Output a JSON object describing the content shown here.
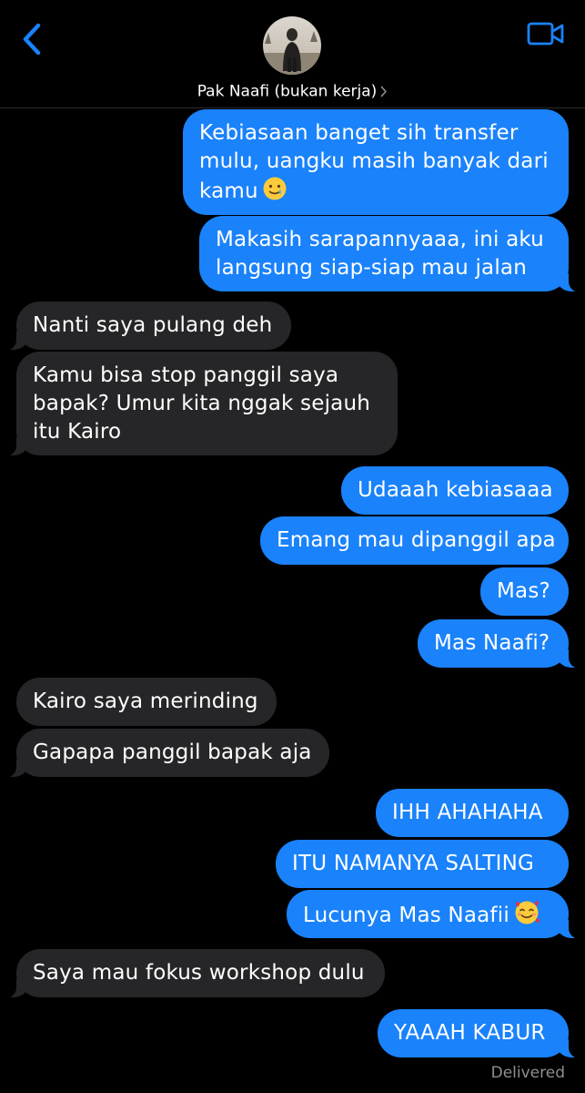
{
  "header": {
    "contact_name": "Pak Naafi (bukan kerja)",
    "back_icon": "chevron-left-icon",
    "video_icon": "video-camera-icon",
    "accent_color": "#1a82fb"
  },
  "messages": [
    {
      "id": 1,
      "from": "me",
      "lines": [
        "Kebiasaan banget sih transfer",
        "mulu, uangku masih banyak dari",
        "kamu"
      ],
      "emoji": "smiling-face-with-tear-icon"
    },
    {
      "id": 2,
      "from": "me",
      "lines": [
        "Makasih sarapannyaaa, ini aku",
        "langsung siap-siap mau jalan"
      ]
    },
    {
      "id": 3,
      "from": "them",
      "lines": [
        "Nanti saya pulang deh"
      ]
    },
    {
      "id": 4,
      "from": "them",
      "lines": [
        "Kamu bisa stop panggil saya",
        "bapak? Umur kita nggak sejauh",
        "itu Kairo"
      ]
    },
    {
      "id": 5,
      "from": "me",
      "lines": [
        "Udaaah kebiasaaa"
      ]
    },
    {
      "id": 6,
      "from": "me",
      "lines": [
        "Emang mau dipanggil apa"
      ]
    },
    {
      "id": 7,
      "from": "me",
      "lines": [
        "Mas?"
      ]
    },
    {
      "id": 8,
      "from": "me",
      "lines": [
        "Mas Naafi?"
      ]
    },
    {
      "id": 9,
      "from": "them",
      "lines": [
        "Kairo saya merinding"
      ]
    },
    {
      "id": 10,
      "from": "them",
      "lines": [
        "Gapapa panggil bapak aja"
      ]
    },
    {
      "id": 11,
      "from": "me",
      "lines": [
        "IHH AHAHAHA"
      ]
    },
    {
      "id": 12,
      "from": "me",
      "lines": [
        "ITU NAMANYA SALTING"
      ]
    },
    {
      "id": 13,
      "from": "me",
      "lines": [
        "Lucunya Mas Naafii"
      ],
      "emoji": "smiling-face-with-hearts-icon"
    },
    {
      "id": 14,
      "from": "them",
      "lines": [
        "Saya mau fokus workshop dulu"
      ]
    },
    {
      "id": 15,
      "from": "me",
      "lines": [
        "YAAAH KABUR"
      ]
    }
  ],
  "status": {
    "delivered": "Delivered"
  },
  "colors": {
    "sent_bubble": "#1a82fb",
    "received_bubble": "#262628",
    "background": "#000000",
    "status_text": "#8e8e93"
  }
}
